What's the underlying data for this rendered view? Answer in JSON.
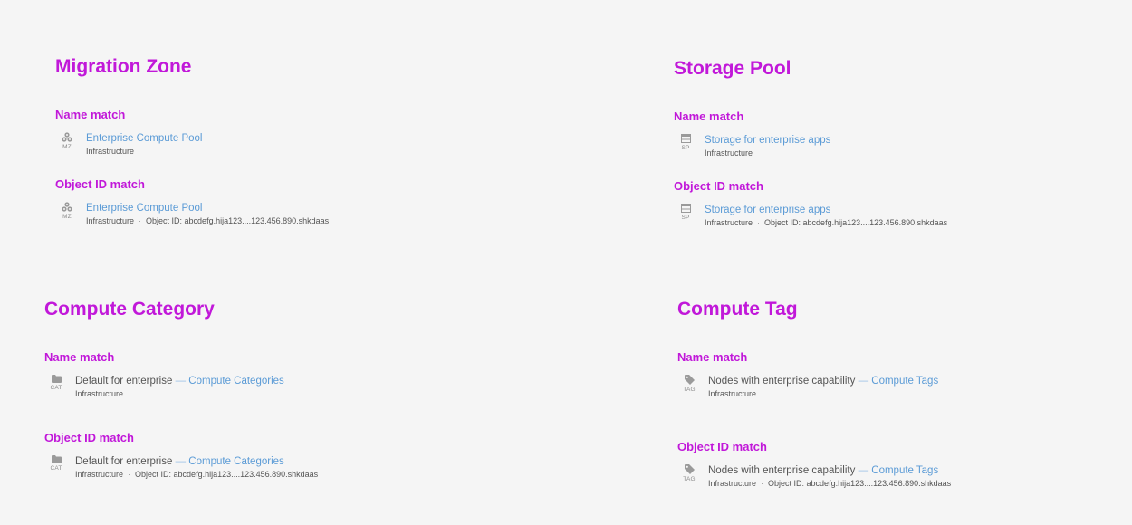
{
  "migration_zone": {
    "title": "Migration Zone",
    "name_match": {
      "label": "Name match",
      "abbr": "MZ",
      "icon": "cluster-icon",
      "link": "Enterprise Compute Pool",
      "category": "Infrastructure"
    },
    "object_id_match": {
      "label": "Object ID match",
      "abbr": "MZ",
      "icon": "cluster-icon",
      "link": "Enterprise Compute Pool",
      "category": "Infrastructure",
      "object_id": "Object ID: abcdefg.hija123....123.456.890.shkdaas"
    }
  },
  "storage_pool": {
    "title": "Storage Pool",
    "name_match": {
      "label": "Name match",
      "abbr": "SP",
      "icon": "table-icon",
      "link": "Storage for enterprise apps",
      "category": "Infrastructure"
    },
    "object_id_match": {
      "label": "Object ID match",
      "abbr": "SP",
      "icon": "table-icon",
      "link": "Storage for enterprise apps",
      "category": "Infrastructure",
      "object_id": "Object ID: abcdefg.hija123....123.456.890.shkdaas"
    }
  },
  "compute_category": {
    "title": "Compute Category",
    "name_match": {
      "label": "Name match",
      "abbr": "CAT",
      "icon": "folder-icon",
      "name": "Default for enterprise",
      "dash": "—",
      "link": "Compute Categories",
      "category": "Infrastructure"
    },
    "object_id_match": {
      "label": "Object ID match",
      "abbr": "CAT",
      "icon": "folder-icon",
      "name": "Default for enterprise",
      "dash": "—",
      "link": "Compute Categories",
      "category": "Infrastructure",
      "object_id": "Object ID: abcdefg.hija123....123.456.890.shkdaas"
    }
  },
  "compute_tag": {
    "title": "Compute Tag",
    "name_match": {
      "label": "Name match",
      "abbr": "TAG",
      "icon": "tag-icon",
      "name": "Nodes with enterprise capability",
      "dash": "—",
      "link": "Compute Tags",
      "category": "Infrastructure"
    },
    "object_id_match": {
      "label": "Object ID match",
      "abbr": "TAG",
      "icon": "tag-icon",
      "name": "Nodes with enterprise capability",
      "dash": "—",
      "link": "Compute Tags",
      "category": "Infrastructure",
      "object_id": "Object ID: abcdefg.hija123....123.456.890.shkdaas"
    }
  },
  "separator": "·",
  "colors": {
    "accent": "#c118d9",
    "link": "#5b9bd6",
    "text": "#555555",
    "background": "#f5f5f5"
  }
}
